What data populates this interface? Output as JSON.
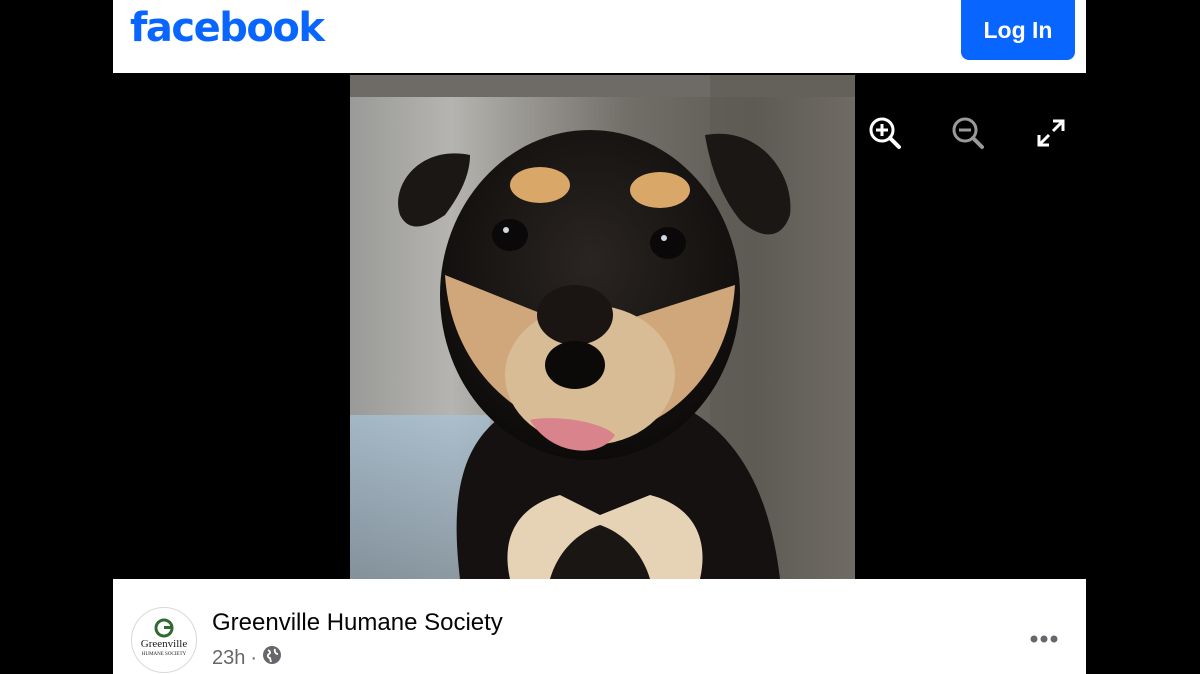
{
  "header": {
    "logo_text": "facebook",
    "login_label": "Log In",
    "brand_color": "#0866ff"
  },
  "viewer": {
    "photo_subject": "puppy-photo",
    "tools": [
      {
        "icon": "zoom-in-icon"
      },
      {
        "icon": "zoom-out-icon"
      },
      {
        "icon": "fullscreen-icon"
      }
    ]
  },
  "post": {
    "page_name": "Greenville Humane Society",
    "avatar_text_line1": "Greenville",
    "avatar_text_line2": "HUMANE SOCIETY",
    "timestamp": "23h",
    "separator": "·",
    "privacy_icon": "globe-icon",
    "more_icon": "more-options-icon"
  }
}
